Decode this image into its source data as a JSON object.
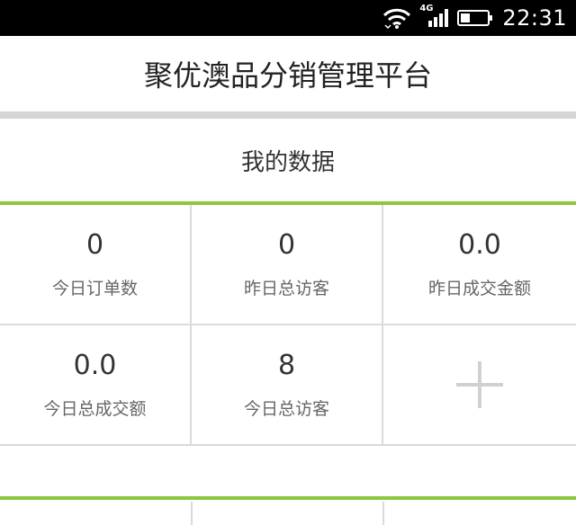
{
  "status_bar": {
    "network_label": "4G",
    "time": "22:31",
    "battery_level": 0.35
  },
  "app": {
    "title": "聚优澳品分销管理平台"
  },
  "section": {
    "title": "我的数据"
  },
  "stats": [
    {
      "value": "0",
      "label": "今日订单数"
    },
    {
      "value": "0",
      "label": "昨日总访客"
    },
    {
      "value": "0.0",
      "label": "昨日成交金额"
    },
    {
      "value": "0.0",
      "label": "今日总成交额"
    },
    {
      "value": "8",
      "label": "今日总访客"
    }
  ],
  "add_tile": {
    "icon": "plus-icon"
  },
  "colors": {
    "accent_green": "#8dc63f",
    "divider_gray": "#d6d6d6"
  }
}
